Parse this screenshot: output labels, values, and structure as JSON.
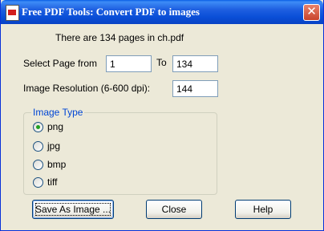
{
  "window": {
    "title": "Free PDF Tools: Convert PDF to images",
    "close_glyph": "✕"
  },
  "info": {
    "pages_text": "There are 134 pages in ch.pdf"
  },
  "page_range": {
    "from_label": "Select Page from",
    "from_value": "1",
    "to_label": "To",
    "to_value": "134"
  },
  "resolution": {
    "label": "Image Resolution (6-600 dpi):",
    "value": "144"
  },
  "image_type": {
    "title": "Image Type",
    "options": [
      {
        "label": "png",
        "selected": true
      },
      {
        "label": "jpg",
        "selected": false
      },
      {
        "label": "bmp",
        "selected": false
      },
      {
        "label": "tiff",
        "selected": false
      }
    ]
  },
  "buttons": {
    "save": "Save As Image ...",
    "close": "Close",
    "help": "Help"
  }
}
